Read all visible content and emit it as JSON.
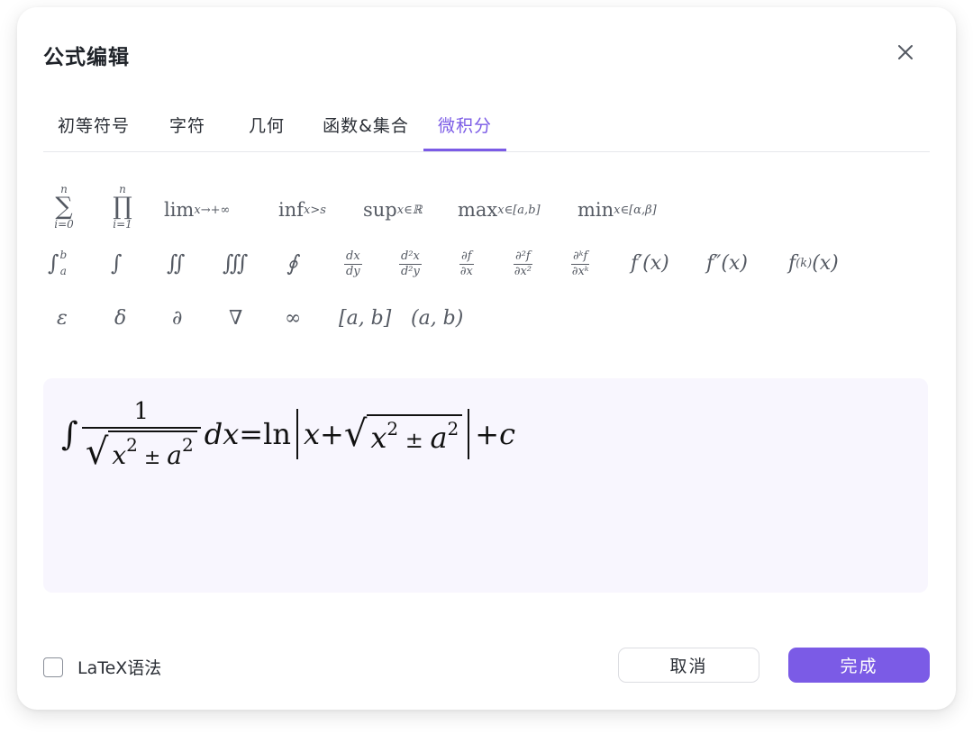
{
  "dialog": {
    "title": "公式编辑",
    "close_icon": "close-icon"
  },
  "tabs": [
    {
      "label": "初等符号",
      "active": false
    },
    {
      "label": "字符",
      "active": false
    },
    {
      "label": "几何",
      "active": false
    },
    {
      "label": "函数&集合",
      "active": false
    },
    {
      "label": "微积分",
      "active": true
    }
  ],
  "symbols": {
    "sum": {
      "op": "∑",
      "upper": "n",
      "lower": "i=0"
    },
    "prod": {
      "op": "∏",
      "upper": "n",
      "lower": "i=1"
    },
    "lim": {
      "base": "lim",
      "sub": "x→+∞"
    },
    "inf": {
      "base": "inf",
      "sub": "x>s"
    },
    "sup": {
      "base": "sup",
      "sub": "x∈ℝ"
    },
    "max": {
      "base": "max",
      "sub": "x∈[a,b]"
    },
    "min": {
      "base": "min",
      "sub": "x∈[α,β]"
    },
    "int_bounds": {
      "op": "∫",
      "upper": "b",
      "lower": "a"
    },
    "int": "∫",
    "iint": "∬",
    "iiint": "∭",
    "oint": "∮",
    "dxdy": {
      "num": "dx",
      "den": "dy"
    },
    "d2xdy2": {
      "num": "d²x",
      "den": "d²y"
    },
    "pfpx": {
      "num": "∂f",
      "den": "∂x"
    },
    "p2fpx2": {
      "num": "∂²f",
      "den": "∂x²"
    },
    "pkfpxk": {
      "num": "∂ᵏf",
      "den": "∂xᵏ"
    },
    "fprime": "f′(x)",
    "fdprime": "f″(x)",
    "fk": {
      "base": "f",
      "sup": "(k)",
      "tail": "(x)"
    },
    "epsilon": "ε",
    "delta": "δ",
    "partial": "∂",
    "nabla": "∇",
    "infinity": "∞",
    "closed_interval": "[a, b]",
    "open_interval": "(a, b)"
  },
  "preview": {
    "integral": "∫",
    "numerator": "1",
    "sqrt": "√",
    "x": "x",
    "sup2": "2",
    "pm": " ± ",
    "a": "a",
    "dx": "dx",
    "eq": " = ",
    "ln": "ln",
    "plus": " + ",
    "c": "c"
  },
  "footer": {
    "latex_label": "LaTeX语法",
    "latex_checked": false,
    "cancel_label": "取消",
    "ok_label": "完成"
  },
  "colors": {
    "accent": "#7b5be6",
    "preview_bg": "#f8f6fe"
  }
}
